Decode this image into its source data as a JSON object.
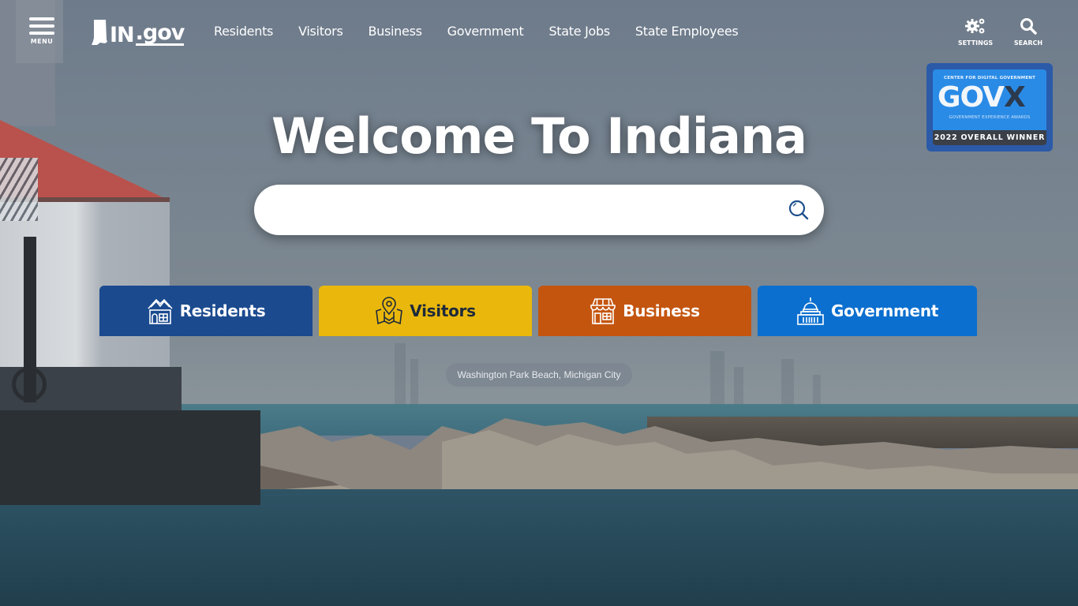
{
  "header": {
    "menu_label": "MENU",
    "logo": {
      "prefix": "IN",
      "suffix": ".gov"
    },
    "nav": [
      "Residents",
      "Visitors",
      "Business",
      "Government",
      "State Jobs",
      "State Employees"
    ],
    "settings_label": "SETTINGS",
    "search_label": "SEARCH"
  },
  "award": {
    "top": "CENTER FOR DIGITAL GOVERNMENT",
    "big": "GOV",
    "big_x": "X",
    "sub": "GOVERNMENT EXPERIENCE AWARDS",
    "winner": "2022 OVERALL WINNER"
  },
  "hero": {
    "title": "Welcome To Indiana",
    "search_value": "",
    "search_placeholder": ""
  },
  "tiles": [
    {
      "label": "Residents",
      "icon": "house-icon",
      "color": "#1b4a8f",
      "text_color": "#ffffff"
    },
    {
      "label": "Visitors",
      "icon": "map-pin-icon",
      "color": "#eab80c",
      "text_color": "#1e2a3a"
    },
    {
      "label": "Business",
      "icon": "storefront-icon",
      "color": "#c4550f",
      "text_color": "#ffffff"
    },
    {
      "label": "Government",
      "icon": "capitol-icon",
      "color": "#0b6fcf",
      "text_color": "#ffffff"
    }
  ],
  "caption": "Washington Park Beach, Michigan City"
}
